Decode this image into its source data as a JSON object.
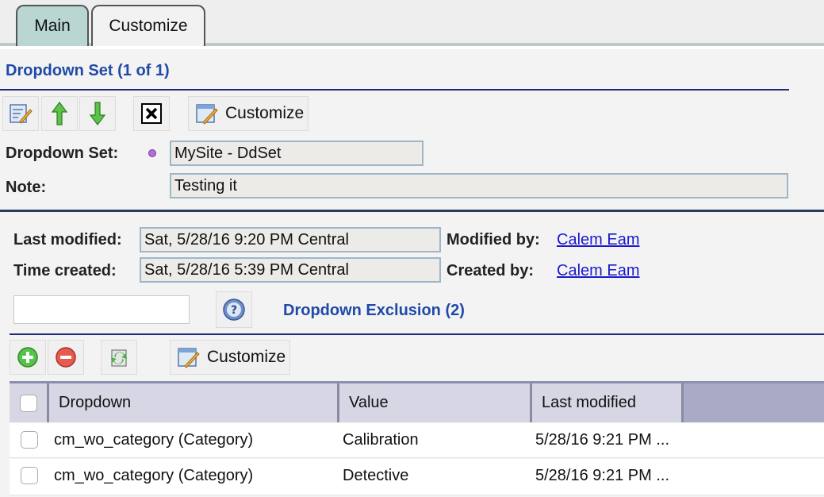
{
  "tabs": [
    {
      "label": "Main"
    },
    {
      "label": "Customize"
    }
  ],
  "dropdown_set": {
    "title": "Dropdown Set (1 of 1)",
    "toolbar": {
      "customize_label": "Customize"
    },
    "fields": {
      "set_label": "Dropdown Set:",
      "set_value": "MySite - DdSet",
      "note_label": "Note:",
      "note_value": "Testing it"
    }
  },
  "audit": {
    "last_modified_label": "Last modified:",
    "last_modified_value": "Sat, 5/28/16 9:20 PM Central",
    "modified_by_label": "Modified by:",
    "modified_by_value": "Calem Eam",
    "time_created_label": "Time created:",
    "time_created_value": "Sat, 5/28/16 5:39 PM Central",
    "created_by_label": "Created by:",
    "created_by_value": "Calem Eam"
  },
  "exclusion": {
    "search_value": "",
    "title": "Dropdown Exclusion (2)",
    "toolbar": {
      "customize_label": "Customize"
    },
    "columns": [
      "Dropdown",
      "Value",
      "Last modified"
    ],
    "rows": [
      {
        "dropdown": "cm_wo_category (Category)",
        "value": "Calibration",
        "last_modified": "5/28/16 9:21 PM ..."
      },
      {
        "dropdown": "cm_wo_category (Category)",
        "value": "Detective",
        "last_modified": "5/28/16 9:21 PM ..."
      }
    ]
  },
  "colors": {
    "accent": "#1f4aa8",
    "link": "#1a1acc",
    "active_tab": "#b9d6d3",
    "grid_header": "#d6d6e4"
  }
}
